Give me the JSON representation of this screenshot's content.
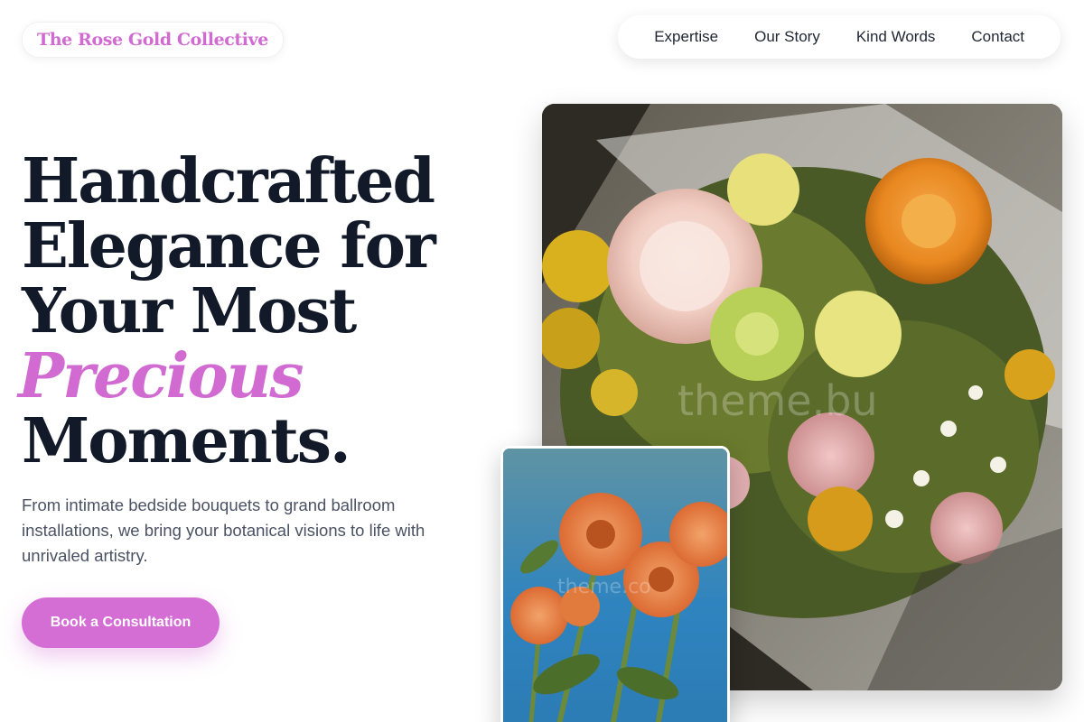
{
  "brand": {
    "name": "The Rose Gold Collective"
  },
  "nav": {
    "items": [
      {
        "label": "Expertise"
      },
      {
        "label": "Our Story"
      },
      {
        "label": "Kind Words"
      },
      {
        "label": "Contact"
      }
    ]
  },
  "hero": {
    "title_lines": [
      "Handcrafted",
      "Elegance for",
      "Your Most"
    ],
    "title_accent": "Precious",
    "title_end": "Moments.",
    "description": "From intimate bedside bouquets to grand ballroom installations, we bring your botanical visions to life with unrivaled artistry.",
    "cta_label": "Book a Consultation"
  },
  "images": {
    "main_watermark": "theme.bu",
    "small_watermark": "theme.co",
    "main_alt": "mixed-flower-bouquet-photo",
    "small_alt": "orange-dahlias-photo"
  },
  "colors": {
    "accent": "#d16bd2",
    "heading": "#121a2a",
    "body_text": "#4a5263"
  }
}
